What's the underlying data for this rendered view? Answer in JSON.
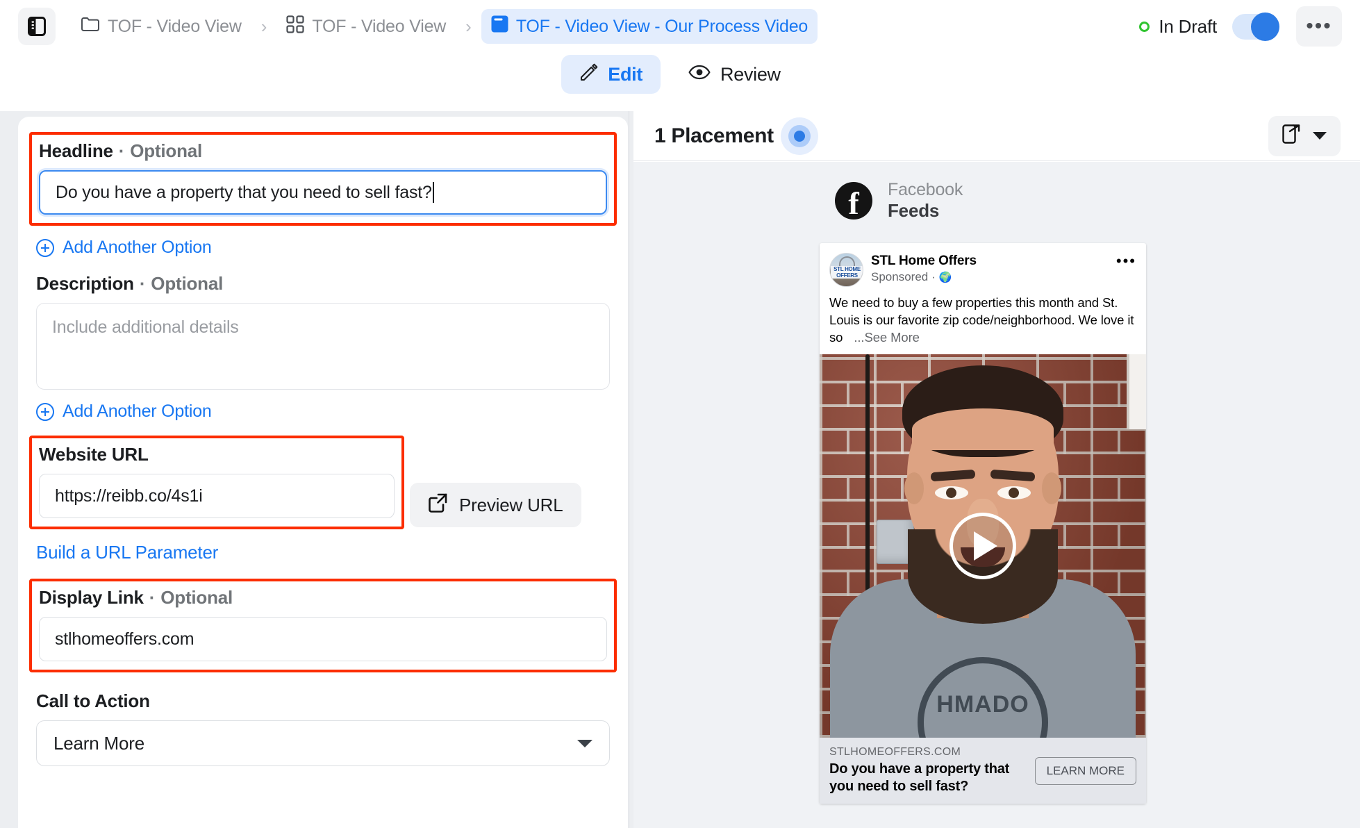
{
  "topbar": {
    "panel_toggle_icon": "sidebar-panel-icon",
    "breadcrumbs": [
      {
        "icon": "folder-icon",
        "label": "TOF - Video View",
        "active": false
      },
      {
        "icon": "grid-icon",
        "label": "TOF - Video View",
        "active": false
      },
      {
        "icon": "ad-document-icon",
        "label": "TOF - Video View - Our Process Video",
        "active": true
      }
    ],
    "separator": "›",
    "status_label": "In Draft",
    "status_color": "#31c431",
    "toggle_on": true,
    "toggle_color": "#2c7be5",
    "more_label": "•••"
  },
  "tabs": [
    {
      "icon": "pencil-icon",
      "label": "Edit",
      "active": true
    },
    {
      "icon": "eye-icon",
      "label": "Review",
      "active": false
    }
  ],
  "form": {
    "headline": {
      "label": "Headline",
      "separator": "·",
      "optional": "Optional",
      "value": "Do you have a property that you need to sell fast?",
      "highlighted": true,
      "focused": true
    },
    "add_option_1": "Add Another Option",
    "description": {
      "label": "Description",
      "separator": "·",
      "optional": "Optional",
      "value": "",
      "placeholder": "Include additional details"
    },
    "add_option_2": "Add Another Option",
    "website_url": {
      "label": "Website URL",
      "value": "https://reibb.co/4s1i",
      "highlighted": true
    },
    "preview_url_button": "Preview URL",
    "build_url_parameter": "Build a URL Parameter",
    "display_link": {
      "label": "Display Link",
      "separator": "·",
      "optional": "Optional",
      "value": "stlhomeoffers.com",
      "highlighted": true
    },
    "call_to_action": {
      "label": "Call to Action",
      "value": "Learn More"
    },
    "highlight_color": "#fc2d00"
  },
  "preview": {
    "placement_count_label": "1 Placement",
    "platform": "Facebook",
    "surface": "Feeds",
    "ad": {
      "page_name": "STL Home Offers",
      "sponsored_label": "Sponsored",
      "sponsored_separator": "·",
      "audience_icon": "globe-icon",
      "menu_label": "•••",
      "avatar_line1": "STL HOME",
      "avatar_line2": "OFFERS",
      "body_text": "We need to buy a few properties this month and St. Louis is our favorite zip code/neighborhood. We love it so",
      "see_more": "...See More",
      "media_type": "video",
      "play_icon": "play-icon",
      "footer_domain": "STLHOMEOFFERS.COM",
      "footer_headline": "Do you have a property that you need to sell fast?",
      "cta_button": "LEARN MORE",
      "shirt_print_text": "HMADO"
    }
  }
}
